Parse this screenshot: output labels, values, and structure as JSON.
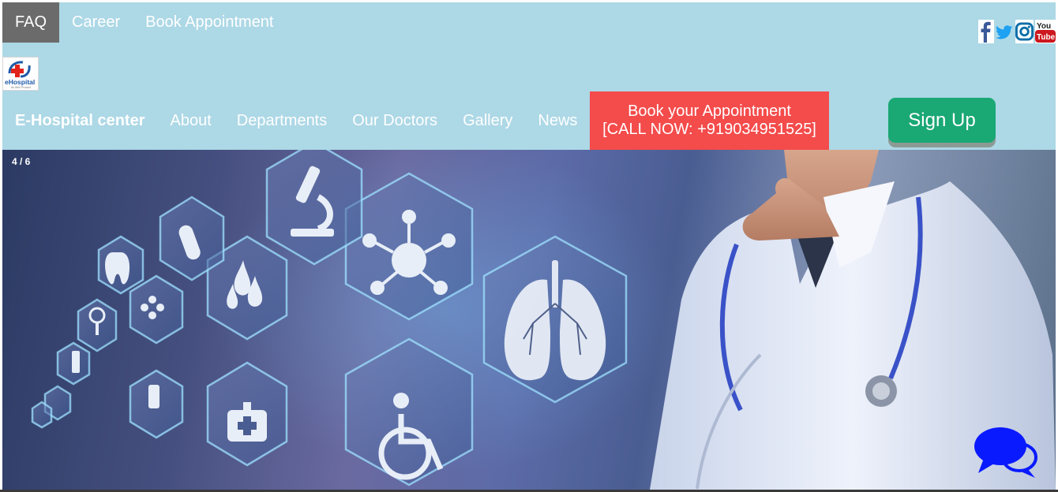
{
  "top_nav": {
    "items": [
      {
        "label": "FAQ"
      },
      {
        "label": "Career"
      },
      {
        "label": "Book Appointment"
      }
    ]
  },
  "social": {
    "icons": [
      "facebook-icon",
      "twitter-icon",
      "instagram-icon",
      "youtube-icon"
    ],
    "youtube_text_1": "You",
    "youtube_text_2": "Tube"
  },
  "logo": {
    "text": "eHospital",
    "tagline": "An Abhi Product"
  },
  "main_nav": {
    "brand": "E-Hospital center",
    "items": [
      {
        "label": "About"
      },
      {
        "label": "Departments"
      },
      {
        "label": "Our Doctors"
      },
      {
        "label": "Gallery"
      },
      {
        "label": "News"
      }
    ],
    "book_line1": "Book your Appointment",
    "book_line2": "[CALL NOW: +919034951525]",
    "signup": "Sign Up"
  },
  "hero": {
    "counter": "4 / 6"
  },
  "colors": {
    "topbar_bg": "#add8e6",
    "book_bg": "#f44b4b",
    "signup_bg": "#1aa874",
    "active_tab": "#6b6b6b",
    "chat_blue": "#0a1aff"
  }
}
